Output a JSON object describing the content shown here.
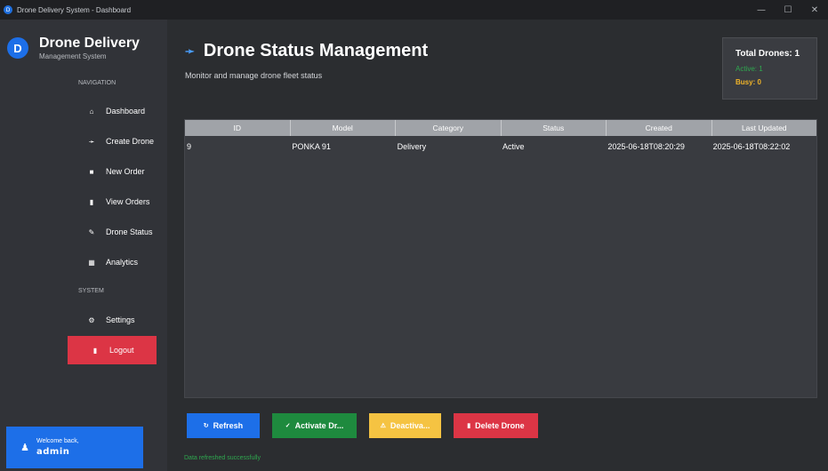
{
  "window": {
    "app_icon": "D",
    "title": "Drone Delivery System - Dashboard",
    "controls": {
      "minimize": "—",
      "maximize": "☐",
      "close": "✕"
    }
  },
  "sidebar": {
    "brand_initial": "D",
    "brand_title": "Drone Delivery",
    "brand_subtitle": "Management System",
    "nav_label": "NAVIGATION",
    "system_label": "SYSTEM",
    "nav_items": [
      {
        "label": "Dashboard",
        "icon": "home-icon",
        "glyph": "⌂"
      },
      {
        "label": "Create Drone",
        "icon": "drone-icon",
        "glyph": "➛"
      },
      {
        "label": "New Order",
        "icon": "briefcase-icon",
        "glyph": "■"
      },
      {
        "label": "View Orders",
        "icon": "clipboard-icon",
        "glyph": "▮"
      },
      {
        "label": "Drone Status",
        "icon": "wrench-icon",
        "glyph": "✎"
      },
      {
        "label": "Analytics",
        "icon": "chart-icon",
        "glyph": "▦"
      }
    ],
    "system_items": [
      {
        "label": "Settings",
        "icon": "gear-icon",
        "glyph": "⚙"
      },
      {
        "label": "Logout",
        "icon": "door-icon",
        "glyph": "▮"
      }
    ],
    "welcome": {
      "greeting": "Welcome back,",
      "username": "admin",
      "icon": "user-icon",
      "glyph": "♟"
    }
  },
  "main": {
    "title_glyph": "➛",
    "title": "Drone Status Management",
    "subtitle": "Monitor and manage drone fleet status",
    "stats": {
      "total": "Total Drones: 1",
      "active": "Active: 1",
      "busy_label": "Busy: ",
      "busy_value": "0"
    },
    "table": {
      "columns": [
        "ID",
        "Model",
        "Category",
        "Status",
        "Created",
        "Last Updated"
      ],
      "rows": [
        [
          "9",
          "PONKA 91",
          "Delivery",
          "Active",
          "2025-06-18T08:20:29",
          "2025-06-18T08:22:02"
        ]
      ]
    },
    "buttons": {
      "refresh": {
        "label": "Refresh",
        "glyph": "↻"
      },
      "activate": {
        "label": "Activate Dr...",
        "glyph": "✓"
      },
      "deactivate": {
        "label": "Deactiva...",
        "glyph": "⚠"
      },
      "delete": {
        "label": "Delete Drone",
        "glyph": "▮"
      }
    },
    "status_message": "Data refreshed successfully"
  },
  "colors": {
    "accent_blue": "#1d6fe8",
    "success_green": "#1e8a3e",
    "warning_yellow": "#f5c342",
    "danger_red": "#dc3545"
  }
}
